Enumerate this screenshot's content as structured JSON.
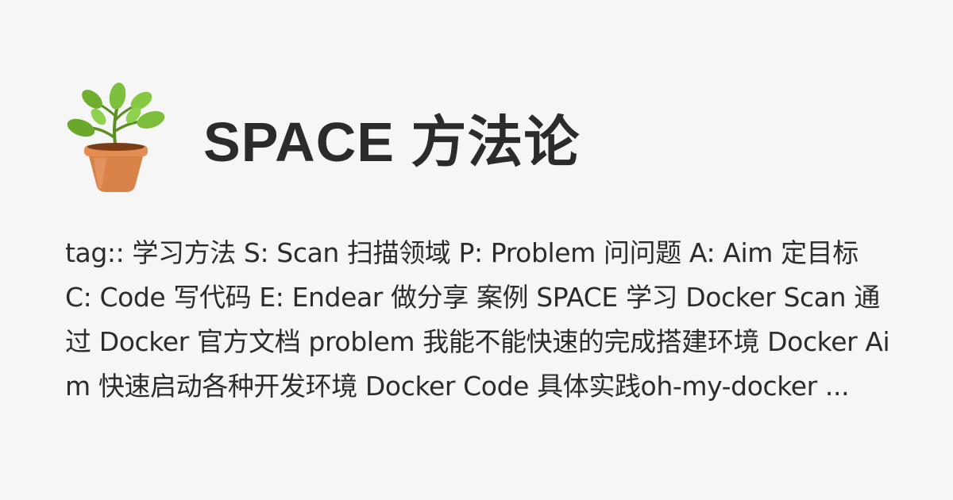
{
  "card": {
    "title": "SPACE 方法论",
    "logo_icon": "potted-plant-icon",
    "description": "tag:: 学习方法 S: Scan 扫描领域 P: Problem 问问题 A: Aim 定目标 C: Code 写代码 E: Endear 做分享 案例 SPACE 学习 Docker Scan 通过 Docker 官方文档 problem 我能不能快速的完成搭建环境 Docker Aim 快速启动各种开发环境 Docker Code 具体实践oh-my-docker ..."
  },
  "colors": {
    "background": "#f6f6f6",
    "text": "#2b2b2b",
    "pot": "#d9824a",
    "leaf": "#6fae2e"
  }
}
